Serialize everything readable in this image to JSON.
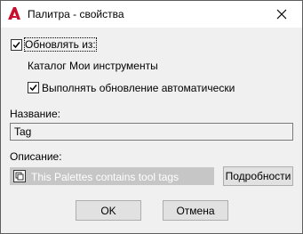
{
  "window": {
    "title": "Палитра - свойства"
  },
  "update_from": {
    "label": "Обновлять из:",
    "checked": true,
    "source": "Каталог Мои инструменты",
    "auto_update_label": "Выполнять обновление автоматически",
    "auto_update_checked": true
  },
  "name_field": {
    "label": "Название:",
    "value": "Tag"
  },
  "description_field": {
    "label": "Описание:",
    "value": "This Palettes contains tool tags",
    "details_button": "Подробности"
  },
  "buttons": {
    "ok": "OK",
    "cancel": "Отмена"
  },
  "colors": {
    "brand_red": "#c8102e",
    "window_bg": "#f0f0f0",
    "description_bg": "#c6c6c6"
  },
  "icons": [
    "autocad-logo-icon",
    "close-icon",
    "checkmark-icon",
    "edit-field-icon"
  ]
}
